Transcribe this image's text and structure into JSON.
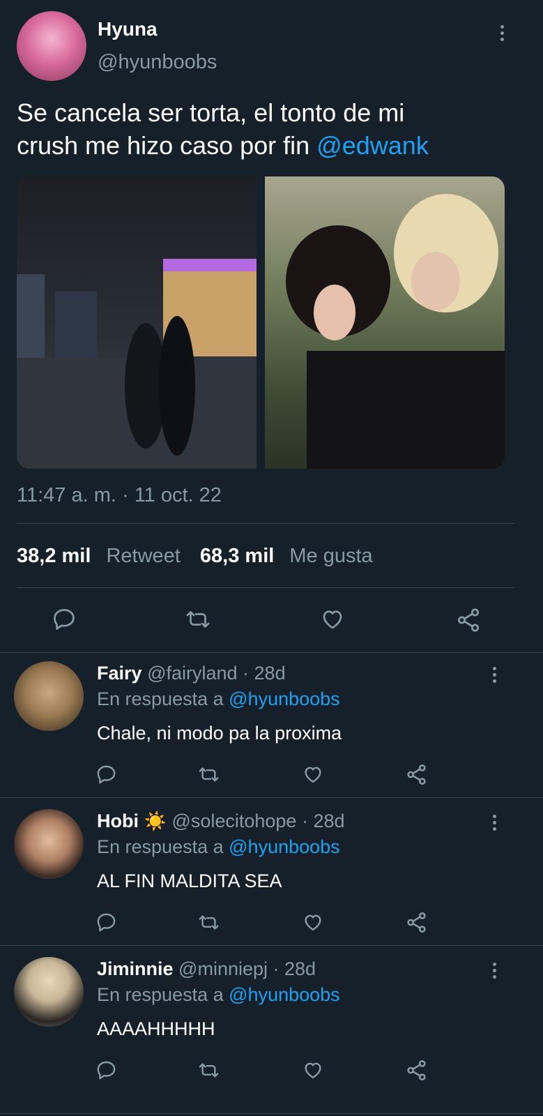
{
  "tweet": {
    "author_name": "Hyuna",
    "author_handle": "@hyunboobs",
    "text_line1": "Se cancela ser torta, el tonto de mi",
    "text_line2_prefix": "crush me hizo caso por fin ",
    "text_mention": "@edwank",
    "timestamp": "11:47 a. m. · 11 oct. 22",
    "retweets_count": "38,2 mil",
    "retweets_label": "Retweet",
    "likes_count": "68,3 mil",
    "likes_label": "Me gusta"
  },
  "replies": [
    {
      "name": "Fairy",
      "emoji": "",
      "handle": "@fairyland",
      "time": "· 28d",
      "reply_to_label": "En respuesta a",
      "reply_to_handle": "@hyunboobs",
      "text": "Chale, ni modo pa la proxima"
    },
    {
      "name": "Hobi",
      "emoji": "☀️",
      "handle": "@solecitohope",
      "time": "· 28d",
      "reply_to_label": "En respuesta a",
      "reply_to_handle": "@hyunboobs",
      "text": "AL FIN MALDITA SEA"
    },
    {
      "name": "Jiminnie",
      "emoji": "",
      "handle": "@minniepj",
      "time": "· 28d",
      "reply_to_label": "En respuesta a",
      "reply_to_handle": "@hyunboobs",
      "text": "AAAAHHHHH"
    }
  ],
  "icons": {
    "reply": "reply-icon",
    "retweet": "retweet-icon",
    "like": "heart-icon",
    "share": "share-icon",
    "more": "more-icon"
  },
  "colors": {
    "background": "#15202b",
    "accent": "#1da1f2",
    "muted": "#8899a6",
    "divider": "#38444d"
  }
}
